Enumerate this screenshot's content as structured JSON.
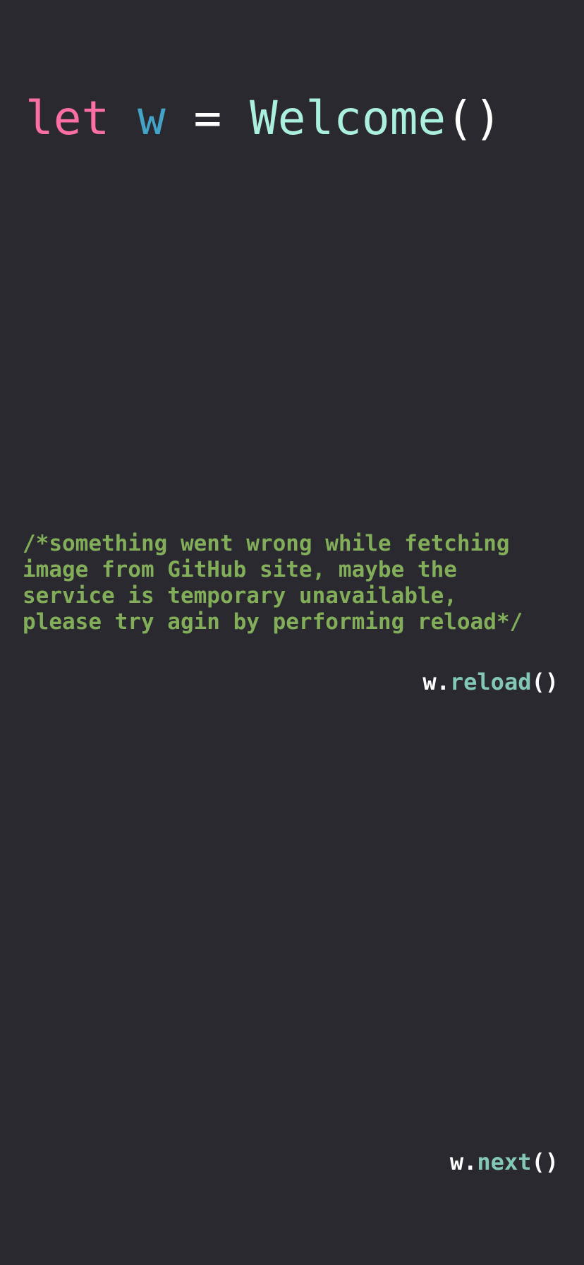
{
  "heading": {
    "keyword": "let",
    "variable": "w",
    "operator": "=",
    "class_name": "Welcome",
    "parens": "()"
  },
  "error_comment": {
    "lines": [
      "/*something went wrong while fetching",
      "image from GitHub site, maybe the",
      "service is temporary unavailable,",
      "please try agin by performing reload*/"
    ]
  },
  "reload_call": {
    "object": "w.",
    "method": "reload",
    "args": "()"
  },
  "next_call": {
    "object": "w.",
    "method": "next",
    "args": "()"
  },
  "colors": {
    "background": "#2a292f",
    "keyword": "#fc6fa4",
    "variable": "#44a4c8",
    "class_name": "#abf0de",
    "comment": "#82ae59",
    "method": "#83c8b6",
    "plain": "#ffffff"
  }
}
